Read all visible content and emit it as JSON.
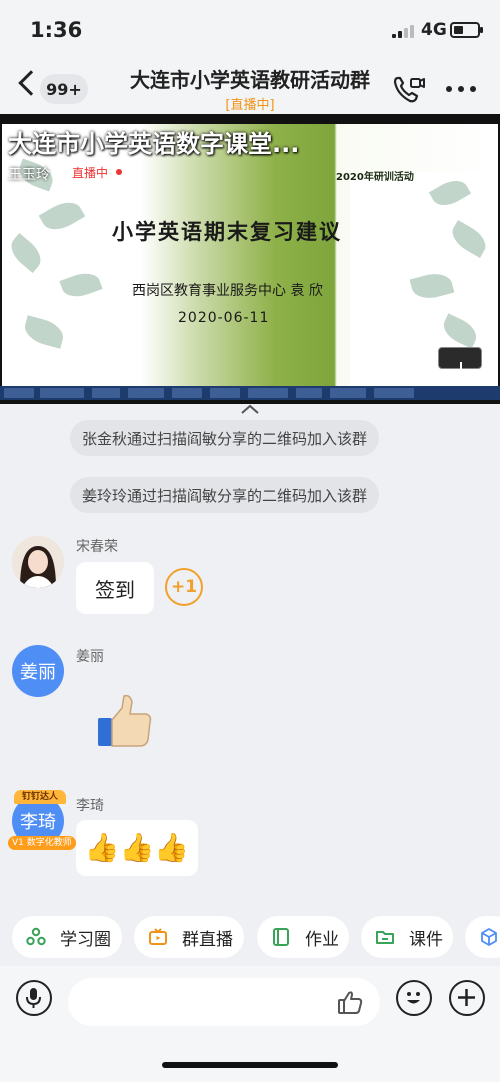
{
  "status_bar": {
    "time": "1:36",
    "network": "4G"
  },
  "header": {
    "unread_count": "99+",
    "title": "大连市小学英语教研活动群",
    "live_tag": "[直播中]"
  },
  "video": {
    "stream_title": "大连市小学英语数字课堂...",
    "streamer": "王玉玲",
    "live_badge": "直播中",
    "slide_tag": "2020年研训活动",
    "slide_heading": "小学英语期末复习建议",
    "slide_org": "西岗区教育事业服务中心 袁 欣",
    "slide_date": "2020-06-11"
  },
  "notices": [
    "张金秋通过扫描阎敏分享的二维码加入该群",
    "姜玲玲通过扫描阎敏分享的二维码加入该群"
  ],
  "messages": [
    {
      "sender": "宋春荣",
      "text": "签到",
      "plus_one": "+1"
    },
    {
      "sender": "姜丽",
      "avatar_text": "姜丽",
      "emoji": "👍"
    },
    {
      "sender": "李琦",
      "avatar_text": "李琦",
      "frame_tag": "钉钉达人",
      "badge": "V1 数字化教师",
      "emoji": "👍👍👍"
    }
  ],
  "chips": [
    {
      "label": "学习圈",
      "icon": "circle-icon"
    },
    {
      "label": "群直播",
      "icon": "live-tv-icon"
    },
    {
      "label": "作业",
      "icon": "homework-icon"
    },
    {
      "label": "课件",
      "icon": "folder-icon"
    },
    {
      "label": "",
      "icon": "cube-icon"
    }
  ],
  "colors": {
    "accent_orange": "#f2a02c",
    "avatar_blue": "#4f8ef5",
    "live_orange": "#f09319"
  }
}
